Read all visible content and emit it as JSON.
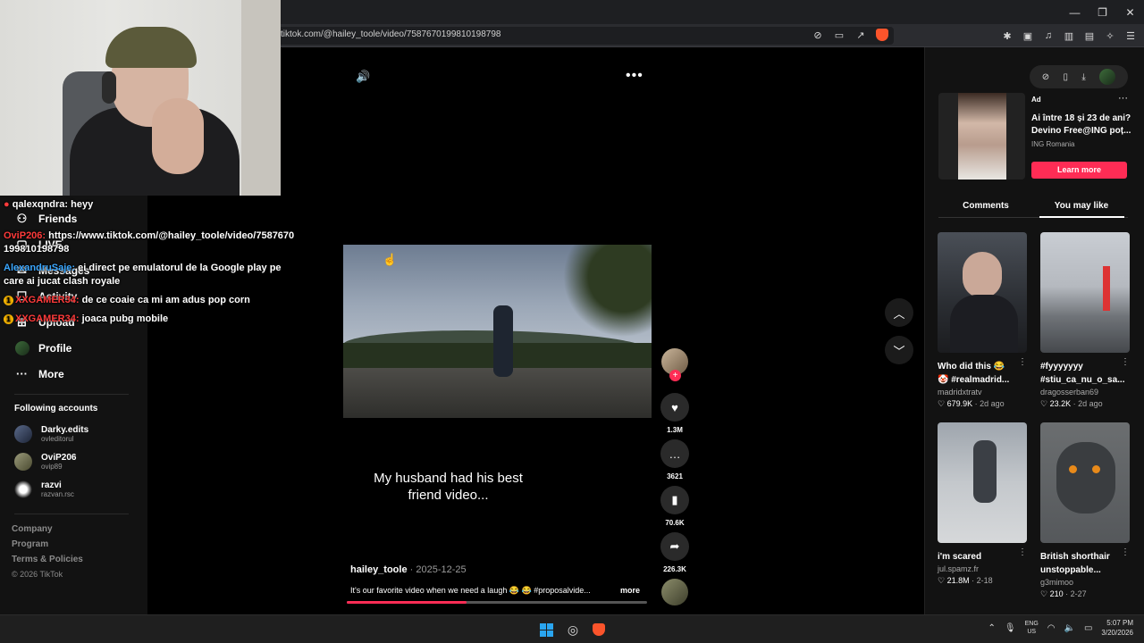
{
  "browser": {
    "url": "tiktok.com/@hailey_toole/video/7587670199810198798",
    "window_controls": [
      "—",
      "❐",
      "✕"
    ]
  },
  "sidebar": {
    "items": [
      {
        "label": "Friends",
        "icon": "friends-icon"
      },
      {
        "label": "LIVE",
        "icon": "live-icon"
      },
      {
        "label": "Messages",
        "icon": "messages-icon"
      },
      {
        "label": "Activity",
        "icon": "activity-icon",
        "badge": "2"
      },
      {
        "label": "Upload",
        "icon": "upload-icon"
      },
      {
        "label": "Profile",
        "icon": "profile-icon"
      },
      {
        "label": "More",
        "icon": "more-icon"
      }
    ],
    "following_title": "Following accounts",
    "accounts": [
      {
        "name": "Darky.edits",
        "handle": "ovleditorul"
      },
      {
        "name": "OviP206",
        "handle": "ovip89"
      },
      {
        "name": "razvi",
        "handle": "razvan.rsc"
      }
    ],
    "footer": [
      "Company",
      "Program",
      "Terms & Policies"
    ],
    "copyright": "© 2026 TikTok"
  },
  "chat": [
    {
      "user": "qalexqndra:",
      "text": " heyy",
      "color": "#ffffff"
    },
    {
      "user": "OviP206:",
      "text": " https://www.tiktok.com/@hailey_toole/video/7587670",
      "text2": "199810198798",
      "color": "#ff3b3b"
    },
    {
      "user": "AlexandruSaje:",
      "text": " ei direct pe emulatorul de la Google play pe",
      "text2": "care ai jucat clash royale",
      "color": "#3ba7ff"
    },
    {
      "user": "XXGAMER34:",
      "text": " de ce coaie ca mi am adus pop corn",
      "color": "#ff3b3b"
    },
    {
      "user": "XXGAMER34:",
      "text": " joaca pubg mobile",
      "color": "#ff3b3b"
    }
  ],
  "video": {
    "caption_line1": "My husband had his best",
    "caption_line2": "friend video...",
    "author": "hailey_toole",
    "date": " · 2025-12-25",
    "description": "It's our favorite video when we need a laugh 😂 😂 #proposalvide...",
    "more": "more",
    "progress": 0.4,
    "counts": {
      "likes": "1.3M",
      "comments": "3621",
      "saves": "70.6K",
      "shares": "226.3K"
    }
  },
  "right_panel": {
    "ad": {
      "label": "Ad",
      "title": "Ai între 18 și 23 de ani? Devino Free@ING poț...",
      "brand": "ING Romania",
      "cta": "Learn more"
    },
    "tabs": [
      "Comments",
      "You may like"
    ],
    "active_tab": "You may like",
    "recommendations": [
      {
        "title": "Who did this 😂 🤡 #realmadrid...",
        "author": "madridxtratv",
        "likes": "679.9K",
        "ago": "2d ago"
      },
      {
        "title": "#fyyyyyyy #stiu_ca_nu_o_sa...",
        "author": "dragosserban69",
        "likes": "23.2K",
        "ago": "2d ago"
      },
      {
        "title": "i'm scared",
        "author": "jul.spamz.fr",
        "likes": "21.8M",
        "ago": "2-18"
      },
      {
        "title": "British shorthair unstoppable...",
        "author": "g3mimoo",
        "likes": "210",
        "ago": "2-27"
      }
    ]
  },
  "taskbar": {
    "lang": "ENG",
    "region": "US",
    "time": "5:07 PM",
    "date": "3/20/2026"
  },
  "colors": {
    "accent": "#fe2c55",
    "panel": "#121212",
    "background": "#000000"
  }
}
